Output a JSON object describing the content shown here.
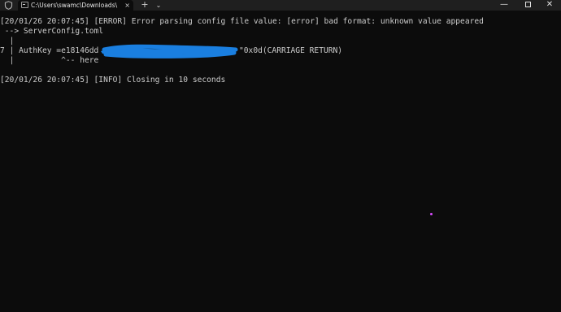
{
  "titlebar": {
    "tab_title": "C:\\Users\\swamc\\Downloads\\",
    "tab_close": "×",
    "new_tab": "+",
    "dropdown": "⌄",
    "minimize": "—",
    "close": "✕"
  },
  "terminal": {
    "lines": [
      "[20/01/26 20:07:45] [ERROR] Error parsing config file value: [error] bad format: unknown value appeared",
      " --> ServerConfig.toml",
      "  |",
      "7 | AuthKey =e18146dd",
      "  |          ^-- here",
      "",
      "[20/01/26 20:07:45] [INFO] Closing in 10 seconds"
    ],
    "line4_suffix": "\"0x0d(CARRIAGE RETURN)"
  },
  "colors": {
    "background": "#0c0c0c",
    "titlebar": "#1f1f1f",
    "text": "#cccccc",
    "redaction": "#1a7fe0"
  }
}
